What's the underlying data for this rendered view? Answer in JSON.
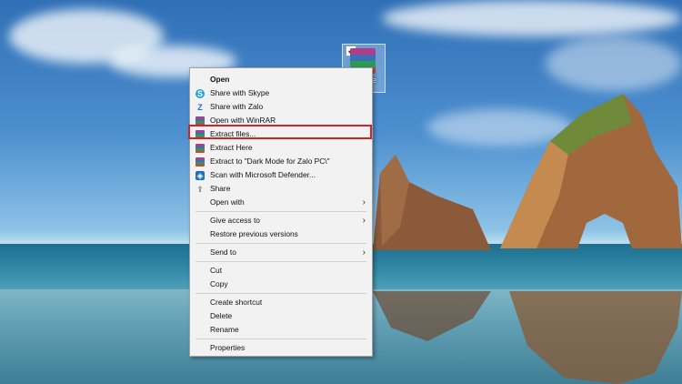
{
  "desktop_icon": {
    "label": "le"
  },
  "context_menu": {
    "items": [
      {
        "label": "Open",
        "bold": true
      },
      {
        "label": "Share with Skype",
        "icon": "skype-icon"
      },
      {
        "label": "Share with Zalo",
        "icon": "zalo-icon"
      },
      {
        "label": "Open with WinRAR",
        "icon": "winrar-icon"
      },
      {
        "label": "Extract files...",
        "icon": "winrar-icon",
        "highlighted": true
      },
      {
        "label": "Extract Here",
        "icon": "winrar-icon"
      },
      {
        "label": "Extract to \"Dark Mode for Zalo PC\\\"",
        "icon": "winrar-icon"
      },
      {
        "label": "Scan with Microsoft Defender...",
        "icon": "defender-icon"
      },
      {
        "label": "Share",
        "icon": "share-icon"
      },
      {
        "label": "Open with",
        "submenu": true
      },
      {
        "label": "Give access to",
        "submenu": true
      },
      {
        "label": "Restore previous versions"
      },
      {
        "label": "Send to",
        "submenu": true
      },
      {
        "label": "Cut"
      },
      {
        "label": "Copy"
      },
      {
        "label": "Create shortcut"
      },
      {
        "label": "Delete"
      },
      {
        "label": "Rename"
      },
      {
        "label": "Properties"
      }
    ],
    "highlight_color": "#d3232a"
  }
}
